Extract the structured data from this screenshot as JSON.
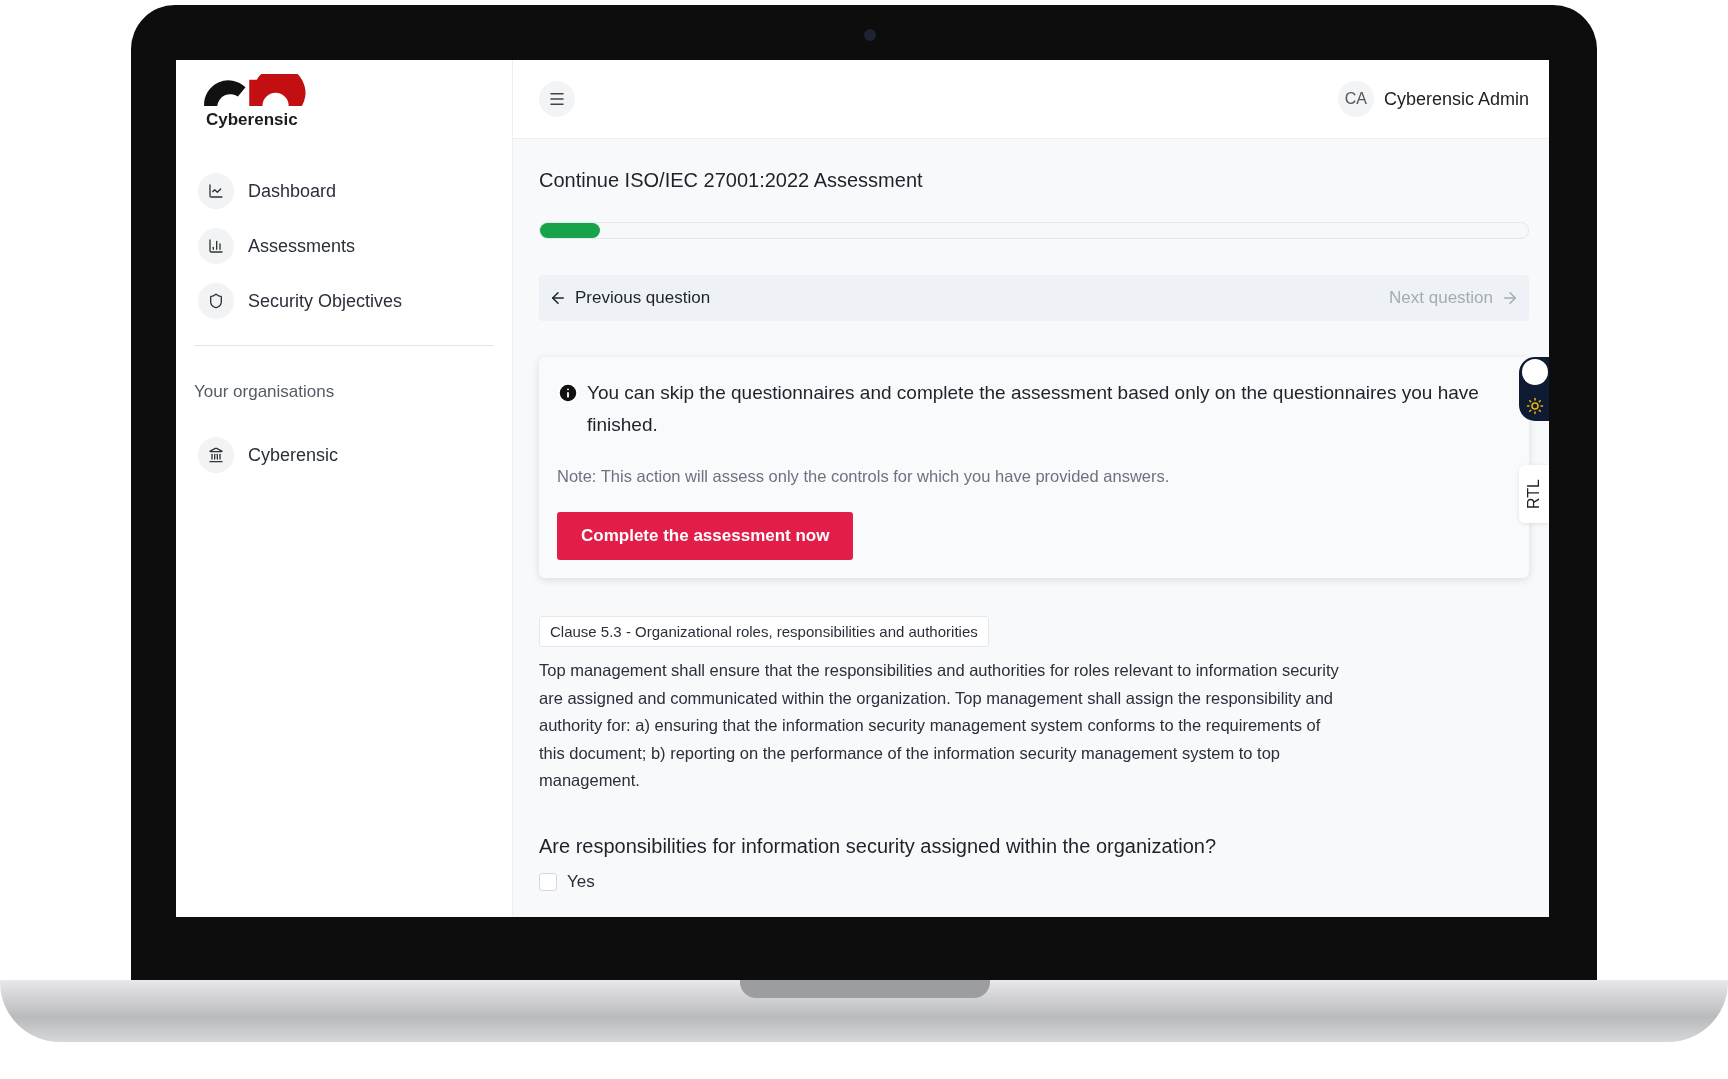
{
  "brand": {
    "name": "Cyberensic"
  },
  "sidebar": {
    "items": [
      {
        "label": "Dashboard"
      },
      {
        "label": "Assessments"
      },
      {
        "label": "Security Objectives"
      }
    ],
    "section_title": "Your organisations",
    "organisations": [
      {
        "label": "Cyberensic"
      }
    ]
  },
  "header": {
    "avatar_initials": "CA",
    "user_name": "Cyberensic Admin"
  },
  "assessment": {
    "title": "Continue ISO/IEC 27001:2022 Assessment",
    "progress": {
      "level": 0.061
    },
    "nav": {
      "previous": {
        "label": "Previous question",
        "disabled": false
      },
      "next": {
        "label": "Next question",
        "disabled": true
      }
    },
    "notice": {
      "message": "You can skip the questionnaires and complete the assessment based only on the questionnaires you have finished.",
      "note": "Note: This action will assess only the controls for which you have provided answers.",
      "button": "Complete the assessment now"
    },
    "clause": {
      "tag": "Clause 5.3 - Organizational roles, responsibilities and authorities",
      "text": "Top management shall ensure that the responsibilities and authorities for roles relevant to information security are assigned and communicated within the organization. Top management shall assign the responsibility and authority for: a) ensuring that the information security management system conforms to the requirements of this document; b) reporting on the performance of the information security management system to top management."
    },
    "question": {
      "text": "Are responsibilities for information security assigned within the organization?",
      "options": [
        {
          "label": "Yes",
          "checked": false
        }
      ]
    }
  },
  "side_tabs": {
    "direction_toggle": "RTL"
  }
}
